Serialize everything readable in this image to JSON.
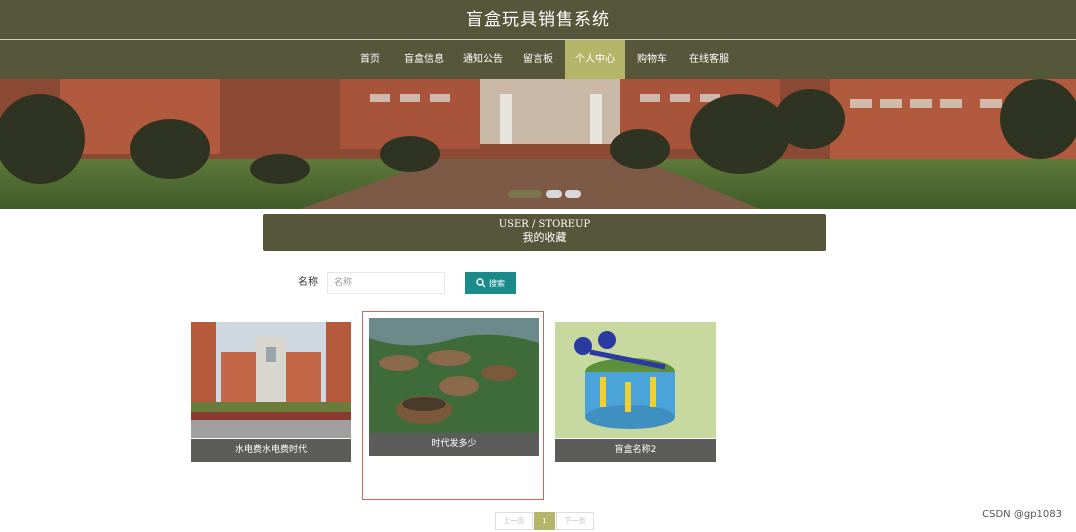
{
  "header": {
    "title": "盲盒玩具销售系统"
  },
  "nav": {
    "items": [
      "首页",
      "盲盒信息",
      "通知公告",
      "留言板",
      "个人中心",
      "购物车",
      "在线客服"
    ],
    "active_index": 4
  },
  "banner": {
    "slide_count": 3,
    "active_slide": 0
  },
  "section": {
    "title_en": "USER / STOREUP",
    "title_cn": "我的收藏"
  },
  "search": {
    "label": "名称",
    "placeholder": "名称",
    "value": "",
    "button_label": "搜索",
    "icon": "search-icon"
  },
  "cards": [
    {
      "caption": "水电费水电费时代"
    },
    {
      "caption": "时代发多少"
    },
    {
      "caption": "盲盒名称2"
    }
  ],
  "pagination": {
    "prev": "上一页",
    "current": "1",
    "next": "下一页"
  },
  "watermark": "CSDN @gp1083",
  "colors": {
    "header_bg": "#56573a",
    "active_nav": "#b5b56a",
    "search_btn": "#1a8a8a",
    "caption_bg": "#5c5c5a"
  }
}
